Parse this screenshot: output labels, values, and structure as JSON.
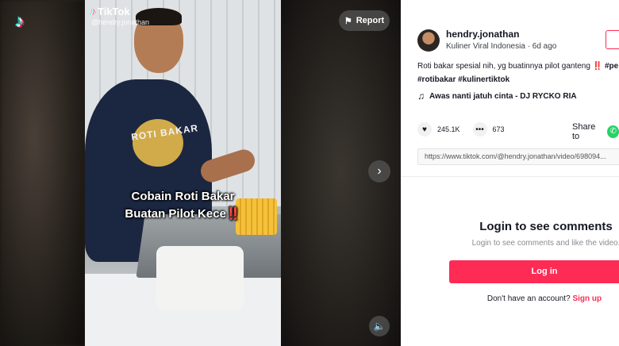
{
  "video": {
    "watermark_brand": "TikTok",
    "watermark_handle": "@hendry.jonathan",
    "caption_line1": "Cobain Roti Bakar",
    "caption_line2": "Buatan Pilot Kece",
    "caption_emoji": "‼️",
    "shirt_print": "ROTI BAKAR",
    "report_label": "Report",
    "icons": [
      "tiktok-logo",
      "flag-icon",
      "chevron-right-icon",
      "volume-icon"
    ]
  },
  "author": {
    "username": "hendry.jonathan",
    "nickname": "Kuliner Viral Indonesia",
    "posted": "6d ago"
  },
  "post": {
    "description_text": "Roti bakar spesial nih, yg buatinnya pilot ganteng ‼️ ",
    "hashtags_line1": "#pe",
    "hashtags_line2": "#rotibakar #kulinertiktok",
    "music": "Awas nanti jatuh cinta - DJ RYCKO RIA",
    "likes": "245.1K",
    "comments": "673",
    "share_label": "Share to",
    "url": "https://www.tiktok.com/@hendry.jonathan/video/698094..."
  },
  "comments": {
    "title": "Login to see comments",
    "subtitle": "Login to see comments and like the video.",
    "login_button": "Log in",
    "no_account": "Don't have an account?",
    "signup": "Sign up"
  },
  "colors": {
    "brand_red": "#fe2c55",
    "whatsapp_green": "#25d366",
    "text_primary": "#161823"
  }
}
